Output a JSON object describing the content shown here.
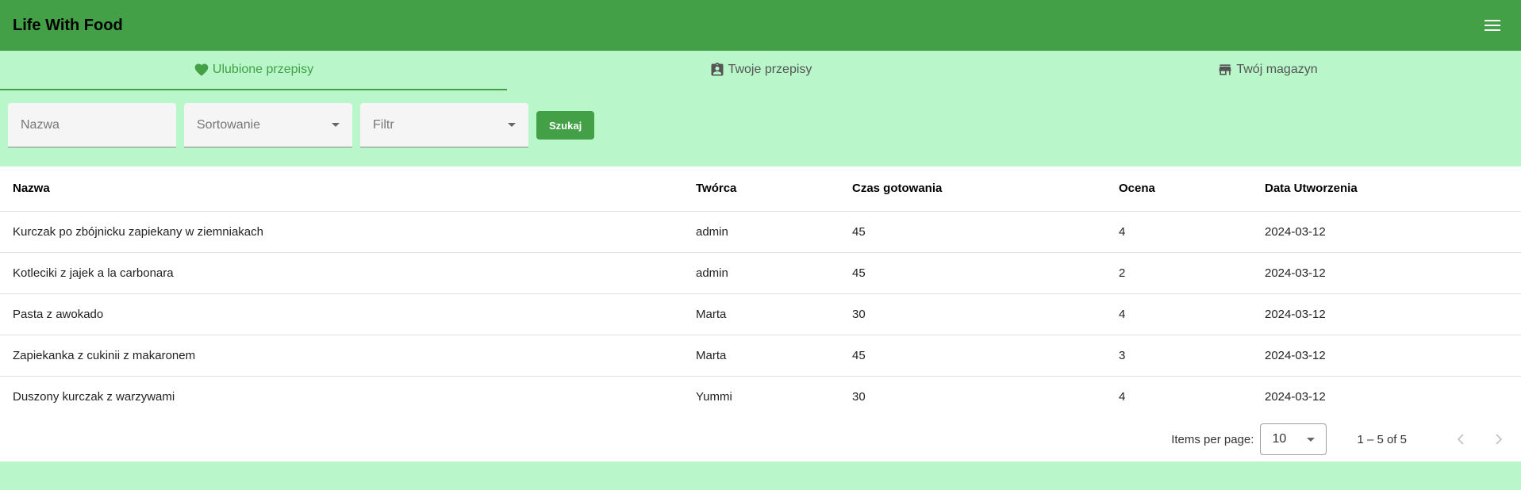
{
  "app": {
    "title": "Life With Food"
  },
  "tabs": [
    {
      "label": "Ulubione przepisy",
      "icon": "heart-icon",
      "active": true
    },
    {
      "label": "Twoje przepisy",
      "icon": "clipboard-user-icon",
      "active": false
    },
    {
      "label": "Twój magazyn",
      "icon": "store-icon",
      "active": false
    }
  ],
  "filters": {
    "name_placeholder": "Nazwa",
    "sort_placeholder": "Sortowanie",
    "filter_placeholder": "Filtr",
    "search_label": "Szukaj"
  },
  "table": {
    "headers": [
      "Nazwa",
      "Twórca",
      "Czas gotowania",
      "Ocena",
      "Data Utworzenia"
    ],
    "rows": [
      [
        "Kurczak po zbójnicku zapiekany w ziemniakach",
        "admin",
        "45",
        "4",
        "2024-03-12"
      ],
      [
        "Kotleciki z jajek a la carbonara",
        "admin",
        "45",
        "2",
        "2024-03-12"
      ],
      [
        "Pasta z awokado",
        "Marta",
        "30",
        "4",
        "2024-03-12"
      ],
      [
        "Zapiekanka z cukinii z makaronem",
        "Marta",
        "45",
        "3",
        "2024-03-12"
      ],
      [
        "Duszony kurczak z warzywami",
        "Yummi",
        "30",
        "4",
        "2024-03-12"
      ]
    ]
  },
  "paginator": {
    "items_label": "Items per page:",
    "page_size": "10",
    "range": "1 – 5 of 5"
  },
  "colors": {
    "primary": "#43a047",
    "background": "#b9f6ca"
  }
}
